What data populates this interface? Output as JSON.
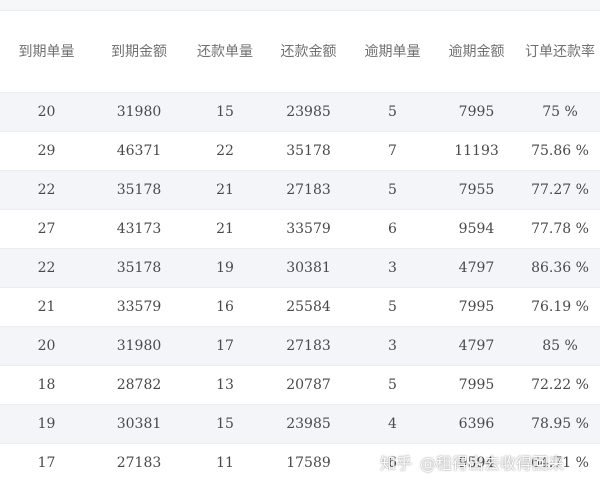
{
  "table": {
    "headers": [
      "到期单量",
      "到期金额",
      "还款单量",
      "还款金额",
      "逾期单量",
      "逾期金额",
      "订单还款率"
    ],
    "rows": [
      [
        "20",
        "31980",
        "15",
        "23985",
        "5",
        "7995",
        "75 %"
      ],
      [
        "29",
        "46371",
        "22",
        "35178",
        "7",
        "11193",
        "75.86 %"
      ],
      [
        "22",
        "35178",
        "21",
        "27183",
        "5",
        "7955",
        "77.27 %"
      ],
      [
        "27",
        "43173",
        "21",
        "33579",
        "6",
        "9594",
        "77.78 %"
      ],
      [
        "22",
        "35178",
        "19",
        "30381",
        "3",
        "4797",
        "86.36 %"
      ],
      [
        "21",
        "33579",
        "16",
        "25584",
        "5",
        "7995",
        "76.19 %"
      ],
      [
        "20",
        "31980",
        "17",
        "27183",
        "3",
        "4797",
        "85 %"
      ],
      [
        "18",
        "28782",
        "13",
        "20787",
        "5",
        "7995",
        "72.22 %"
      ],
      [
        "19",
        "30381",
        "15",
        "23985",
        "4",
        "6396",
        "78.95 %"
      ],
      [
        "17",
        "27183",
        "11",
        "17589",
        "6",
        "9594",
        "64.71 %"
      ]
    ]
  },
  "watermark": {
    "logo": "知乎",
    "handle": "@租得出去收得回来"
  }
}
